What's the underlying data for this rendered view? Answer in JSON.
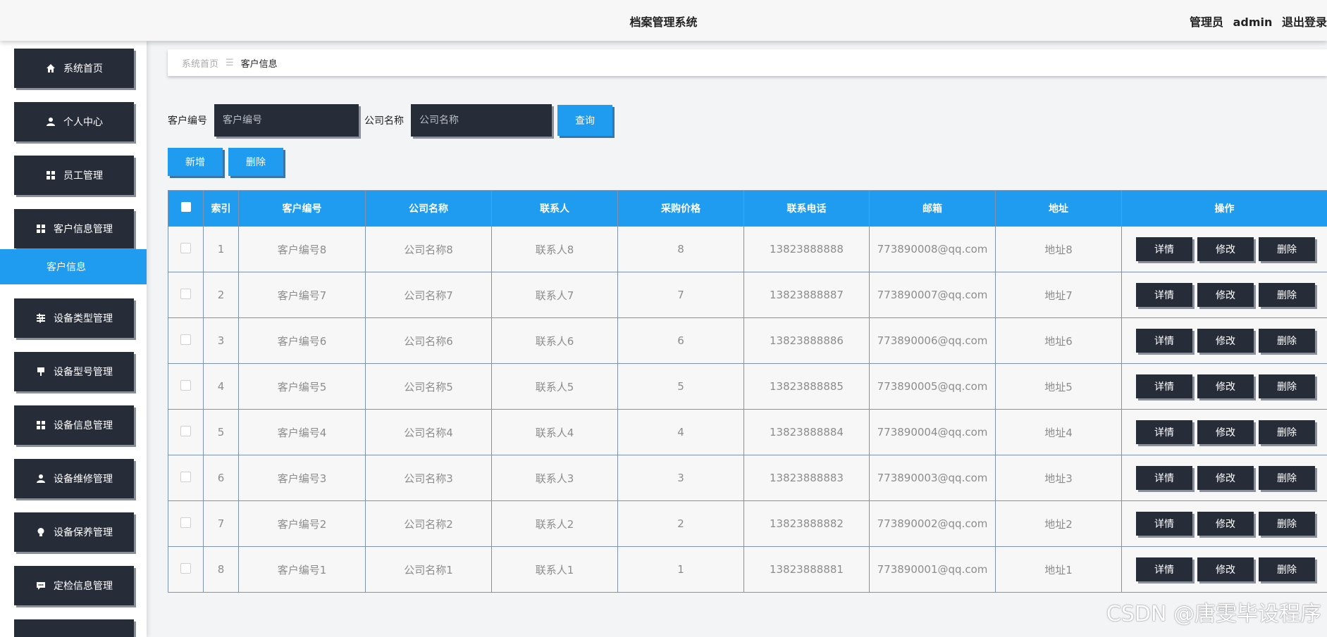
{
  "header": {
    "title": "档案管理系统",
    "role": "管理员",
    "username": "admin",
    "logout": "退出登录"
  },
  "sidebar": {
    "items": [
      {
        "label": "系统首页",
        "icon": "home-icon"
      },
      {
        "label": "个人中心",
        "icon": "user-icon"
      },
      {
        "label": "员工管理",
        "icon": "grid-icon"
      },
      {
        "label": "客户信息管理",
        "icon": "grid-icon"
      },
      {
        "label": "设备类型管理",
        "icon": "sliders-icon"
      },
      {
        "label": "设备型号管理",
        "icon": "pin-icon"
      },
      {
        "label": "设备信息管理",
        "icon": "grid-icon"
      },
      {
        "label": "设备维修管理",
        "icon": "user-icon"
      },
      {
        "label": "设备保养管理",
        "icon": "bulb-icon"
      },
      {
        "label": "定检信息管理",
        "icon": "chat-icon"
      }
    ],
    "active_sub": "客户信息"
  },
  "breadcrumb": {
    "home": "系统首页",
    "separator": "☰",
    "current": "客户信息"
  },
  "search": {
    "customer_no_label": "客户编号",
    "customer_no_placeholder": "客户编号",
    "company_label": "公司名称",
    "company_placeholder": "公司名称",
    "query_button": "查询"
  },
  "actions": {
    "add": "新增",
    "delete": "删除"
  },
  "table": {
    "columns": [
      "",
      "索引",
      "客户编号",
      "公司名称",
      "联系人",
      "采购价格",
      "联系电话",
      "邮箱",
      "地址",
      "操作"
    ],
    "op_labels": {
      "detail": "详情",
      "edit": "修改",
      "delete": "删除"
    },
    "rows": [
      {
        "index": "1",
        "customer_no": "客户编号8",
        "company": "公司名称8",
        "contact": "联系人8",
        "price": "8",
        "phone": "13823888888",
        "email": "773890008@qq.com",
        "address": "地址8"
      },
      {
        "index": "2",
        "customer_no": "客户编号7",
        "company": "公司名称7",
        "contact": "联系人7",
        "price": "7",
        "phone": "13823888887",
        "email": "773890007@qq.com",
        "address": "地址7"
      },
      {
        "index": "3",
        "customer_no": "客户编号6",
        "company": "公司名称6",
        "contact": "联系人6",
        "price": "6",
        "phone": "13823888886",
        "email": "773890006@qq.com",
        "address": "地址6"
      },
      {
        "index": "4",
        "customer_no": "客户编号5",
        "company": "公司名称5",
        "contact": "联系人5",
        "price": "5",
        "phone": "13823888885",
        "email": "773890005@qq.com",
        "address": "地址5"
      },
      {
        "index": "5",
        "customer_no": "客户编号4",
        "company": "公司名称4",
        "contact": "联系人4",
        "price": "4",
        "phone": "13823888884",
        "email": "773890004@qq.com",
        "address": "地址4"
      },
      {
        "index": "6",
        "customer_no": "客户编号3",
        "company": "公司名称3",
        "contact": "联系人3",
        "price": "3",
        "phone": "13823888883",
        "email": "773890003@qq.com",
        "address": "地址3"
      },
      {
        "index": "7",
        "customer_no": "客户编号2",
        "company": "公司名称2",
        "contact": "联系人2",
        "price": "2",
        "phone": "13823888882",
        "email": "773890002@qq.com",
        "address": "地址2"
      },
      {
        "index": "8",
        "customer_no": "客户编号1",
        "company": "公司名称1",
        "contact": "联系人1",
        "price": "1",
        "phone": "13823888881",
        "email": "773890001@qq.com",
        "address": "地址1"
      }
    ]
  },
  "watermark": "CSDN @唐雯毕设程序"
}
